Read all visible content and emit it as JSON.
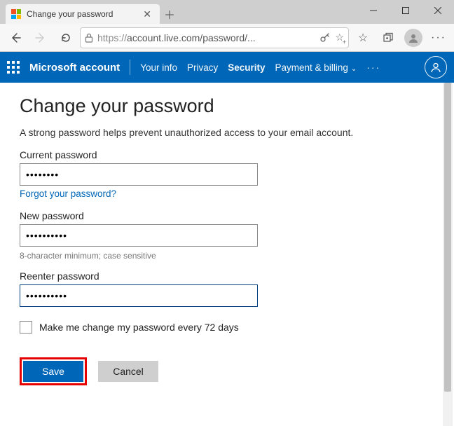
{
  "browser": {
    "tab_title": "Change your password",
    "url_display": "account.live.com/password/...",
    "url_protocol": "https://"
  },
  "appbar": {
    "brand": "Microsoft account",
    "links": {
      "your_info": "Your info",
      "privacy": "Privacy",
      "security": "Security",
      "payment": "Payment & billing"
    }
  },
  "page": {
    "heading": "Change your password",
    "description": "A strong password helps prevent unauthorized access to your email account.",
    "current_label": "Current password",
    "current_value": "••••••••",
    "forgot_link": "Forgot your password?",
    "new_label": "New password",
    "new_value": "••••••••••",
    "hint": "8-character minimum; case sensitive",
    "reenter_label": "Reenter password",
    "reenter_value": "••••••••••",
    "checkbox_label": "Make me change my password every 72 days",
    "save": "Save",
    "cancel": "Cancel"
  }
}
